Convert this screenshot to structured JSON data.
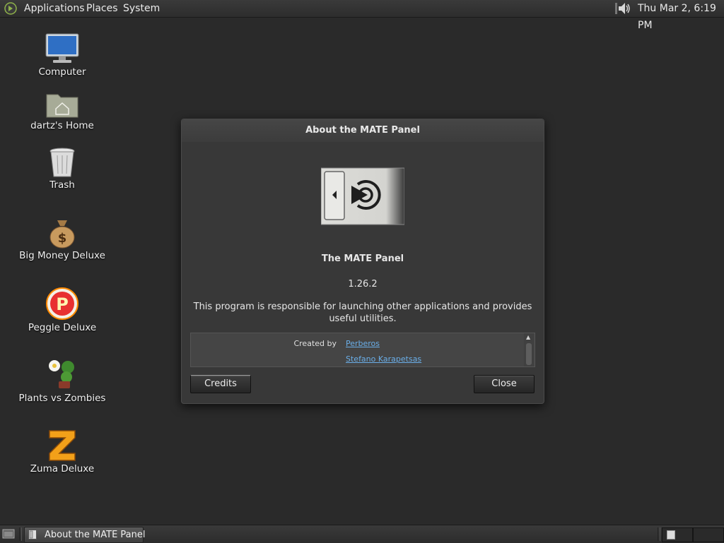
{
  "top_panel": {
    "menus": [
      "Applications",
      "Places",
      "System"
    ],
    "clock": "Thu Mar  2,  6:19 PM",
    "logo_icon": "mate-logo-icon",
    "volume_icon": "speaker-icon"
  },
  "desktop_icons": [
    {
      "label": "Computer",
      "icon": "computer-icon"
    },
    {
      "label": "dartz's Home",
      "icon": "home-folder-icon"
    },
    {
      "label": "Trash",
      "icon": "trash-icon"
    },
    {
      "label": "Big Money Deluxe",
      "icon": "money-bag-icon"
    },
    {
      "label": "Peggle Deluxe",
      "icon": "peggle-icon"
    },
    {
      "label": "Plants vs Zombies",
      "icon": "plants-icon"
    },
    {
      "label": "Zuma Deluxe",
      "icon": "zuma-icon"
    }
  ],
  "dialog": {
    "title": "About the MATE Panel",
    "program_name": "The MATE Panel",
    "version": "1.26.2",
    "description": "This program is responsible for launching other applications and provides useful utilities.",
    "created_by_label": "Created by",
    "authors": [
      "Perberos",
      "Stefano Karapetsas"
    ],
    "credits_button": "Credits",
    "close_button": "Close"
  },
  "bottom_panel": {
    "task_label": "About the MATE Panel"
  },
  "colors": {
    "desktop": "#2a2a2a",
    "dialog_bg": "#383838",
    "link": "#6aaee8"
  }
}
